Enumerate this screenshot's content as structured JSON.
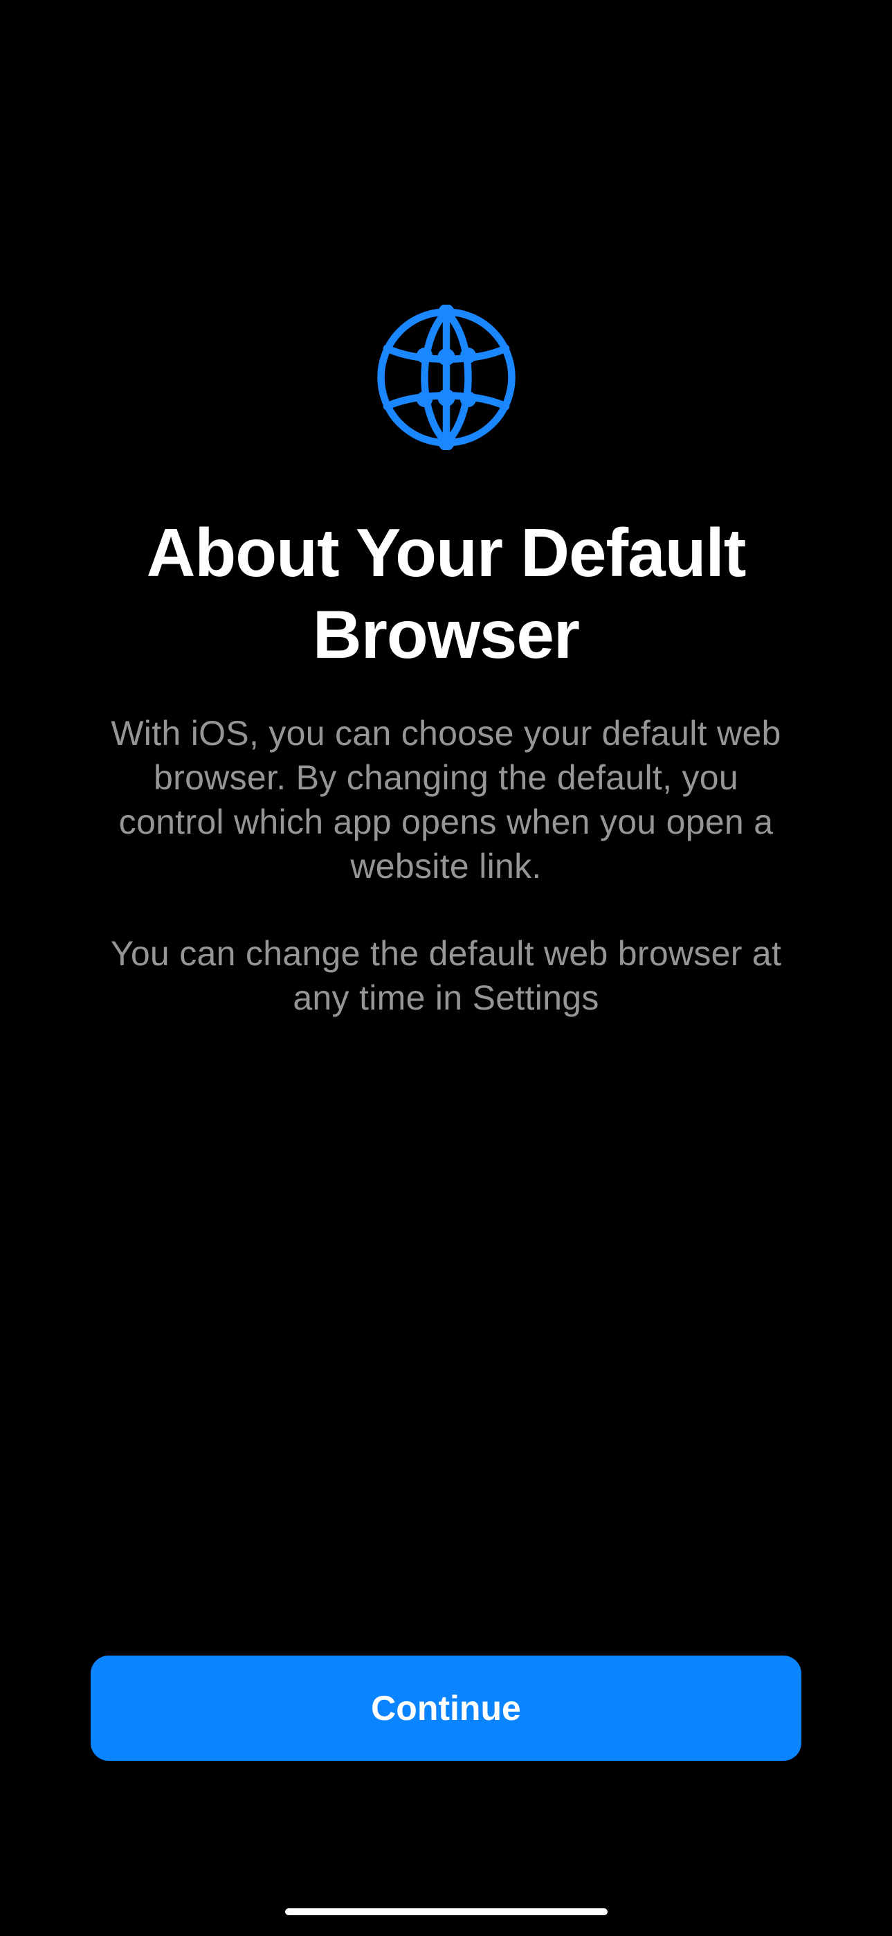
{
  "icon": {
    "name": "globe-icon",
    "color": "#0a84ff"
  },
  "title": "About Your Default Browser",
  "description_primary": "With iOS, you can choose your default web browser. By changing the default, you control which app opens when you open a website link.",
  "description_secondary": "You can change the default web browser at any time in Settings",
  "button": {
    "continue_label": "Continue"
  }
}
